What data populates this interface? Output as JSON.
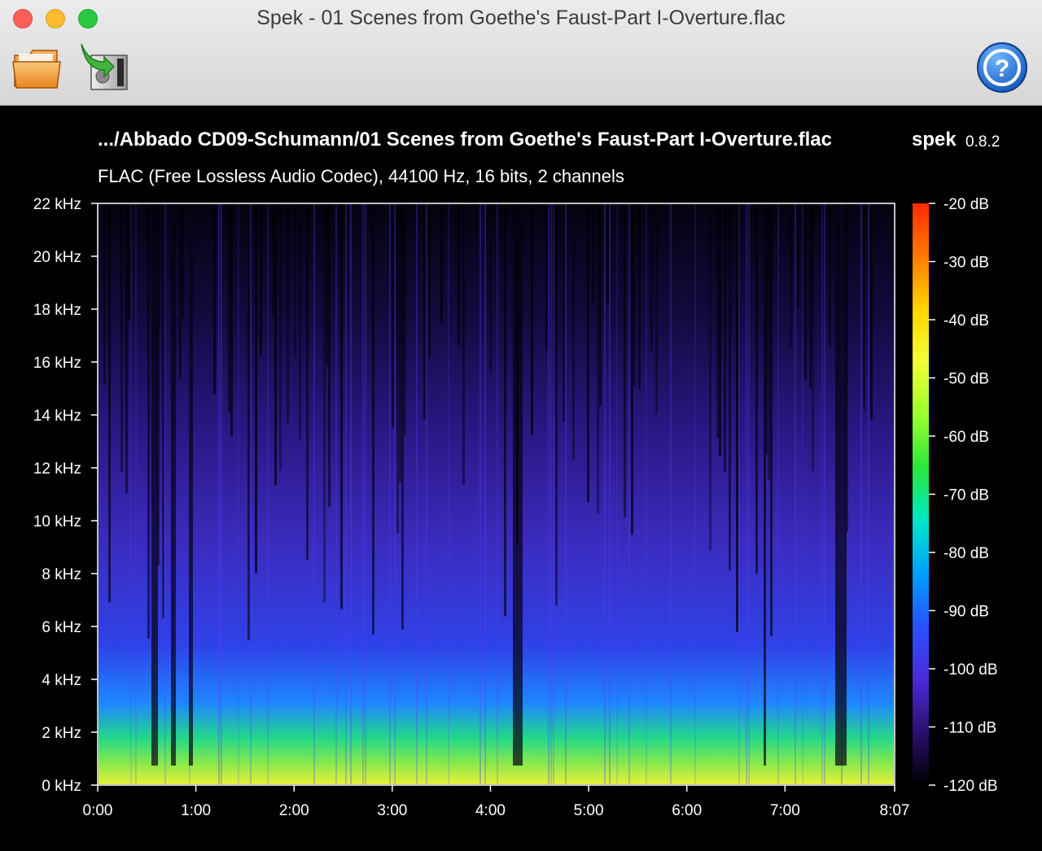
{
  "window": {
    "title": "Spek - 01 Scenes from Goethe's Faust-Part I-Overture.flac",
    "traffic_lights": {
      "close": "#fc5f57",
      "minimize": "#fdbb2e",
      "zoom": "#29c841"
    }
  },
  "toolbar": {
    "open_icon": "folder-open-icon",
    "save_icon": "save-image-icon",
    "help_icon": "help-icon"
  },
  "header": {
    "file_path": ".../Abbado CD09-Schumann/01 Scenes from Goethe's Faust-Part I-Overture.flac",
    "app_name": "spek",
    "app_version": "0.8.2",
    "file_info": "FLAC (Free Lossless Audio Codec), 44100 Hz, 16 bits, 2 channels"
  },
  "spectrogram": {
    "y_axis": {
      "labels": [
        "0 kHz",
        "2 kHz",
        "4 kHz",
        "6 kHz",
        "8 kHz",
        "10 kHz",
        "12 kHz",
        "14 kHz",
        "16 kHz",
        "18 kHz",
        "20 kHz",
        "22 kHz"
      ],
      "min_khz": 0,
      "max_khz": 22
    },
    "x_axis": {
      "labels": [
        "0:00",
        "1:00",
        "2:00",
        "3:00",
        "4:00",
        "5:00",
        "6:00",
        "7:00",
        "8:07"
      ],
      "duration_seconds": 487
    },
    "legend": {
      "labels": [
        "-20 dB",
        "-30 dB",
        "-40 dB",
        "-50 dB",
        "-60 dB",
        "-70 dB",
        "-80 dB",
        "-90 dB",
        "-100 dB",
        "-110 dB",
        "-120 dB"
      ],
      "colors": [
        "#ff2a00",
        "#ff7a00",
        "#ffd400",
        "#f0ff3a",
        "#9aff2e",
        "#2be63c",
        "#00e6c8",
        "#00a0ff",
        "#2950ff",
        "#4a2cd8",
        "#2a0f6e",
        "#000000"
      ]
    }
  }
}
